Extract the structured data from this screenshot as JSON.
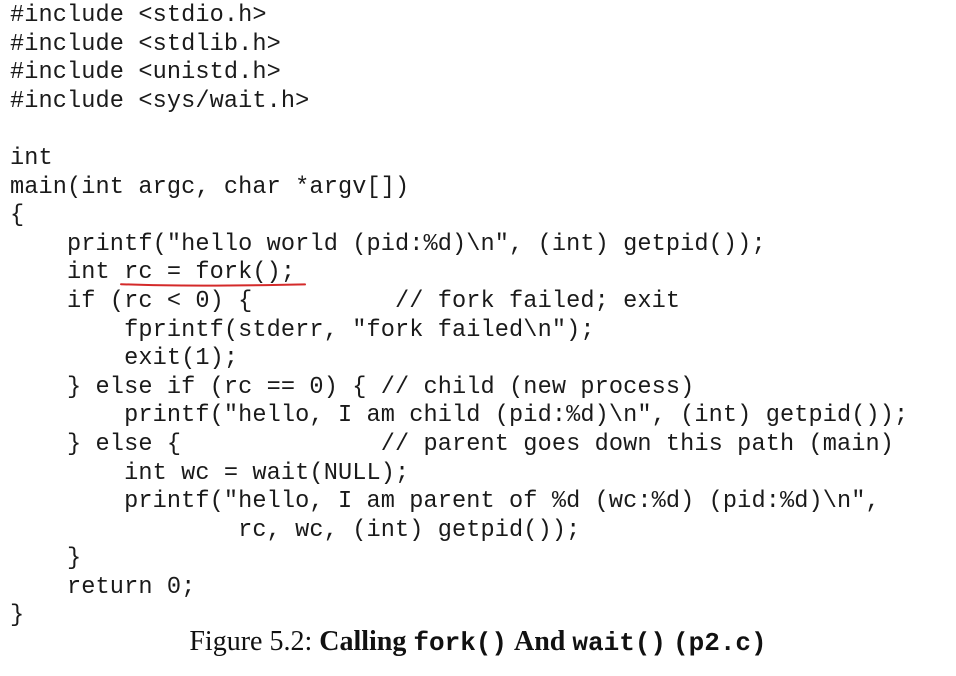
{
  "code": {
    "lines": [
      "#include <stdio.h>",
      "#include <stdlib.h>",
      "#include <unistd.h>",
      "#include <sys/wait.h>",
      "",
      "int",
      "main(int argc, char *argv[])",
      "{",
      "    printf(\"hello world (pid:%d)\\n\", (int) getpid());",
      "    int rc = fork();",
      "    if (rc < 0) {          // fork failed; exit",
      "        fprintf(stderr, \"fork failed\\n\");",
      "        exit(1);",
      "    } else if (rc == 0) { // child (new process)",
      "        printf(\"hello, I am child (pid:%d)\\n\", (int) getpid());",
      "    } else {              // parent goes down this path (main)",
      "        int wc = wait(NULL);",
      "        printf(\"hello, I am parent of %d (wc:%d) (pid:%d)\\n\",",
      "                rc, wc, (int) getpid());",
      "    }",
      "    return 0;",
      "}"
    ]
  },
  "annotation": {
    "underline_color": "#d42a2a"
  },
  "caption": {
    "prefix": "Figure 5.2: ",
    "word_calling": "Calling",
    "fn_fork": "fork()",
    "word_and": "And",
    "fn_wait": "wait()",
    "file": "(p2.c)"
  }
}
